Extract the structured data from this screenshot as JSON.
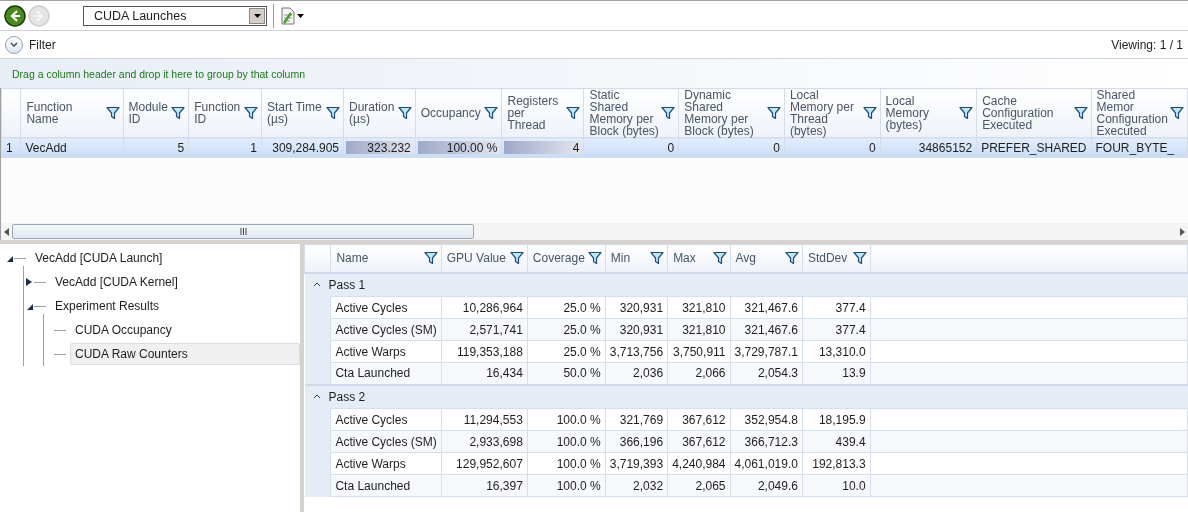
{
  "toolbar": {
    "back_disabled": false,
    "forward_disabled": true,
    "view_select": "CUDA Launches"
  },
  "filter": {
    "label": "Filter",
    "expanded": false,
    "viewing": "Viewing: 1 / 1"
  },
  "group_hint": "Drag a column header and drop it here to group by that column",
  "launches_table": {
    "columns": [
      {
        "label": "Function Name"
      },
      {
        "label": "Module ID"
      },
      {
        "label": "Function ID"
      },
      {
        "label": "Start Time (µs)"
      },
      {
        "label": "Duration (µs)"
      },
      {
        "label": "Occupancy"
      },
      {
        "label": "Registers per Thread"
      },
      {
        "label": "Static Shared Memory per Block (bytes)"
      },
      {
        "label": "Dynamic Shared Memory per Block (bytes)"
      },
      {
        "label": "Local Memory per Thread (bytes)"
      },
      {
        "label": "Local Memory (bytes)"
      },
      {
        "label": "Cache Configuration Executed"
      },
      {
        "label": "Shared Memor Configuration Executed"
      }
    ],
    "rows": [
      {
        "number": "1",
        "selected": true,
        "cells": [
          {
            "text": "VecAdd"
          },
          {
            "text": "5"
          },
          {
            "text": "1"
          },
          {
            "text": "309,284.905"
          },
          {
            "text": "323.232",
            "level": 1
          },
          {
            "text": "100.00 %",
            "level": 1
          },
          {
            "text": "4",
            "level": 1
          },
          {
            "text": "0"
          },
          {
            "text": "0"
          },
          {
            "text": "0"
          },
          {
            "text": "34865152"
          },
          {
            "text": "PREFER_SHARED"
          },
          {
            "text": "FOUR_BYTE_"
          }
        ]
      }
    ]
  },
  "tree": [
    {
      "label": "VecAdd [CUDA Launch]",
      "expanded": true,
      "selected": false,
      "children": [
        {
          "label": "VecAdd [CUDA Kernel]",
          "expanded": false,
          "selected": false
        },
        {
          "label": "Experiment Results",
          "expanded": true,
          "selected": false,
          "children": [
            {
              "label": "CUDA Occupancy",
              "selected": false
            },
            {
              "label": "CUDA Raw Counters",
              "selected": true
            }
          ]
        }
      ]
    }
  ],
  "counters_table": {
    "columns": [
      "Name",
      "GPU Value",
      "Coverage",
      "Min",
      "Max",
      "Avg",
      "StdDev"
    ],
    "groups": [
      {
        "label": "Pass 1",
        "expanded": true,
        "rows": [
          [
            "Active Cycles",
            "10,286,964",
            "25.0 %",
            "320,931",
            "321,810",
            "321,467.6",
            "377.4"
          ],
          [
            "Active Cycles (SM)",
            "2,571,741",
            "25.0 %",
            "320,931",
            "321,810",
            "321,467.6",
            "377.4"
          ],
          [
            "Active Warps",
            "119,353,188",
            "25.0 %",
            "3,713,756",
            "3,750,911",
            "3,729,787.1",
            "13,310.0"
          ],
          [
            "Cta Launched",
            "16,434",
            "50.0 %",
            "2,036",
            "2,066",
            "2,054.3",
            "13.9"
          ]
        ]
      },
      {
        "label": "Pass 2",
        "expanded": true,
        "rows": [
          [
            "Active Cycles",
            "11,294,553",
            "100.0 %",
            "321,769",
            "367,612",
            "352,954.8",
            "18,195.9"
          ],
          [
            "Active Cycles (SM)",
            "2,933,698",
            "100.0 %",
            "366,196",
            "367,612",
            "366,712.3",
            "439.4"
          ],
          [
            "Active Warps",
            "129,952,607",
            "100.0 %",
            "3,719,393",
            "4,240,984",
            "4,061,019.0",
            "192,813.3"
          ],
          [
            "Cta Launched",
            "16,397",
            "100.0 %",
            "2,032",
            "2,065",
            "2,049.6",
            "10.0"
          ]
        ]
      }
    ]
  }
}
